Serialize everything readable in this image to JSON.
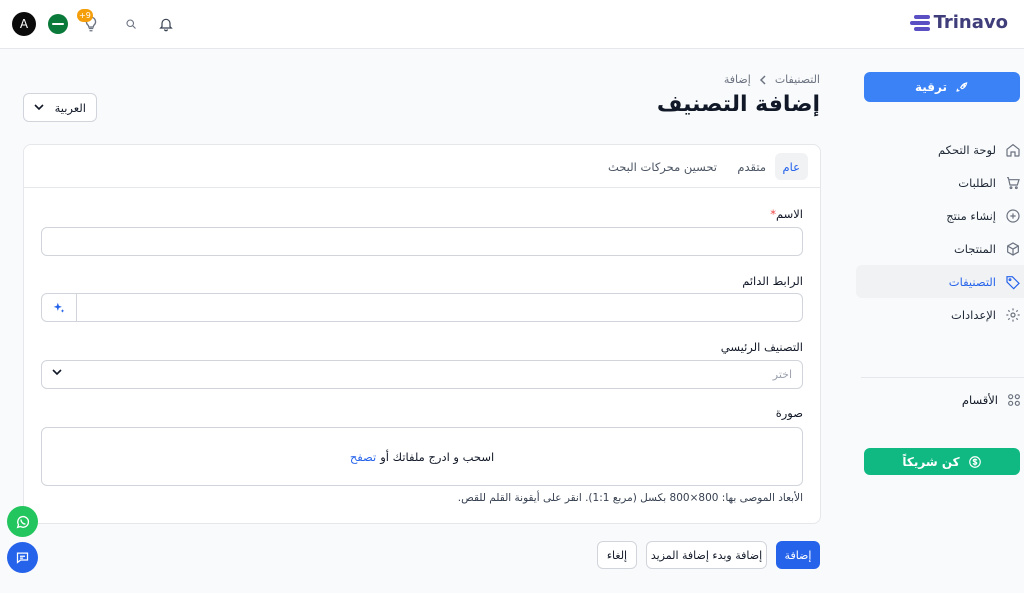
{
  "brand": {
    "name": "Trinavo",
    "color": "#5b4fc4"
  },
  "topbar": {
    "avatar_letter": "A",
    "notification_count": "+9",
    "icons": [
      "flag-icon",
      "lightbulb-icon",
      "search-icon",
      "bell-icon"
    ]
  },
  "sidebar": {
    "upgrade_label": "ترقية",
    "items": [
      {
        "label": "لوحة التحكم",
        "icon": "home-icon",
        "active": false
      },
      {
        "label": "الطلبات",
        "icon": "cart-icon",
        "active": false
      },
      {
        "label": "إنشاء منتج",
        "icon": "plus-circle-icon",
        "active": false
      },
      {
        "label": "المنتجات",
        "icon": "box-icon",
        "active": false
      },
      {
        "label": "التصنيفات",
        "icon": "tag-icon",
        "active": true
      },
      {
        "label": "الإعدادات",
        "icon": "gear-icon",
        "active": false
      }
    ],
    "sections_label": "الأقسام",
    "partner_label": "كن شريكاً"
  },
  "breadcrumb": {
    "parent": "التصنيفات",
    "current": "إضافة"
  },
  "page_title": "إضافة التصنيف",
  "language_select": {
    "value": "العربية"
  },
  "tabs": [
    {
      "label": "عام",
      "active": true
    },
    {
      "label": "متقدم",
      "active": false
    },
    {
      "label": "تحسين محركات البحث",
      "active": false
    }
  ],
  "form": {
    "name_label": "الاسم",
    "required_mark": "*",
    "permalink_label": "الرابط الدائم",
    "parent_label": "التصنيف الرئيسي",
    "parent_placeholder": "اختر",
    "image_label": "صورة",
    "dropzone_text": "اسحب و ادرج ملفاتك أو",
    "dropzone_link": "تصفح",
    "hint": "الأبعاد الموصى بها: 800×800 بكسل (مربع 1:1). انقر على أيقونة القلم للقص."
  },
  "actions": {
    "add": "إضافة",
    "add_more": "إضافة وبدء إضافة المزيد",
    "cancel": "إلغاء"
  },
  "colors": {
    "primary": "#2563eb",
    "upgrade": "#3b82f6",
    "partner": "#10b981",
    "whatsapp": "#22c55e"
  }
}
